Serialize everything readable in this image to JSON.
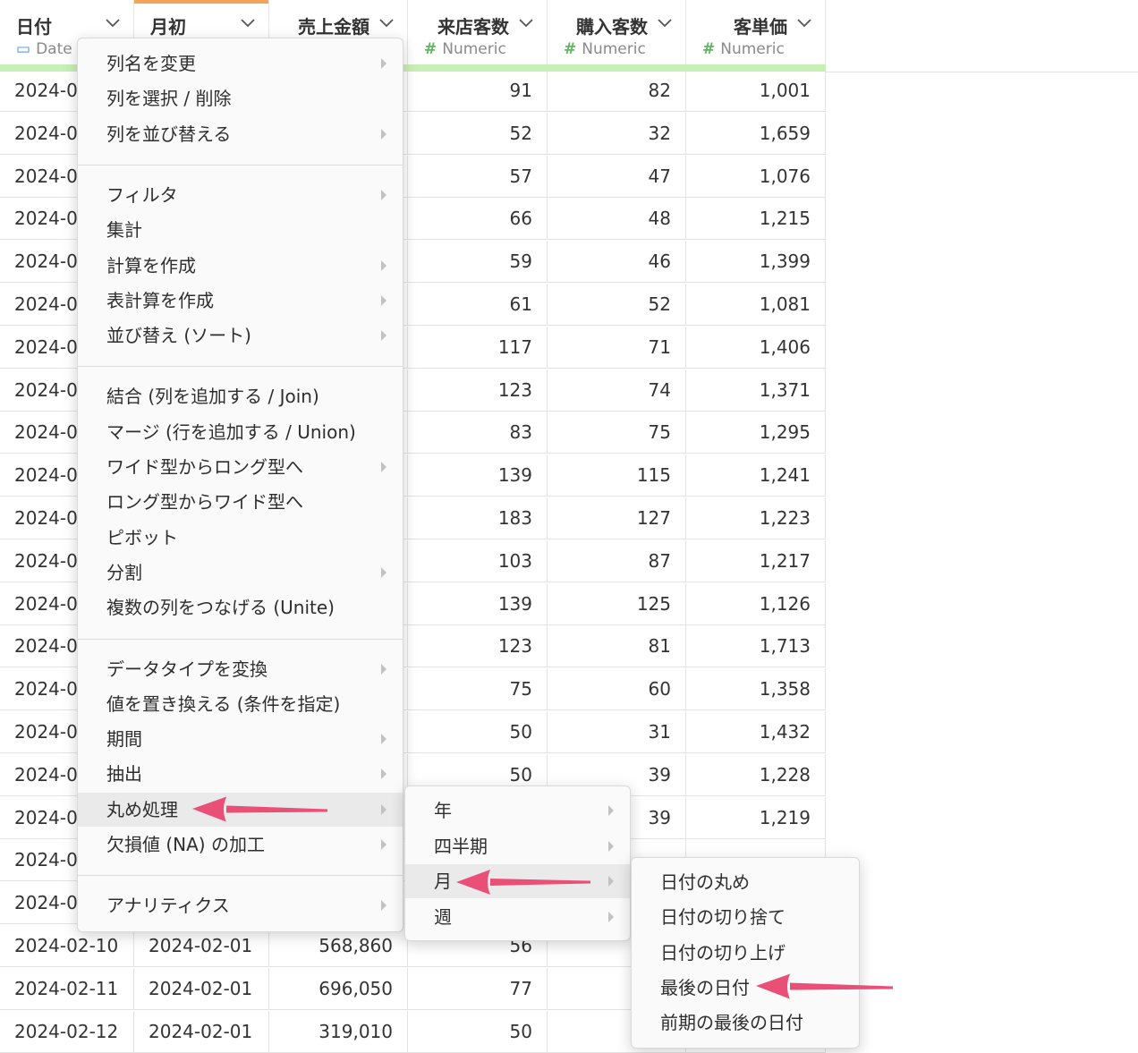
{
  "columns": [
    {
      "name": "日付",
      "type": "Date"
    },
    {
      "name": "月初",
      "type": ""
    },
    {
      "name": "売上金額",
      "type": ""
    },
    {
      "name": "来店客数",
      "type": "Numeric"
    },
    {
      "name": "購入客数",
      "type": "Numeric"
    },
    {
      "name": "客単価",
      "type": "Numeric"
    }
  ],
  "rows": [
    [
      "2024-0",
      "",
      "",
      "91",
      "82",
      "1,001"
    ],
    [
      "2024-0",
      "",
      "",
      "52",
      "32",
      "1,659"
    ],
    [
      "2024-0",
      "",
      "",
      "57",
      "47",
      "1,076"
    ],
    [
      "2024-0",
      "",
      "",
      "66",
      "48",
      "1,215"
    ],
    [
      "2024-0",
      "",
      "",
      "59",
      "46",
      "1,399"
    ],
    [
      "2024-0",
      "",
      "",
      "61",
      "52",
      "1,081"
    ],
    [
      "2024-0",
      "",
      "",
      "117",
      "71",
      "1,406"
    ],
    [
      "2024-0",
      "",
      "",
      "123",
      "74",
      "1,371"
    ],
    [
      "2024-0",
      "",
      "",
      "83",
      "75",
      "1,295"
    ],
    [
      "2024-0",
      "",
      "",
      "139",
      "115",
      "1,241"
    ],
    [
      "2024-0",
      "",
      "",
      "183",
      "127",
      "1,223"
    ],
    [
      "2024-0",
      "",
      "",
      "103",
      "87",
      "1,217"
    ],
    [
      "2024-0",
      "",
      "",
      "139",
      "125",
      "1,126"
    ],
    [
      "2024-0",
      "",
      "",
      "123",
      "81",
      "1,713"
    ],
    [
      "2024-0",
      "",
      "",
      "75",
      "60",
      "1,358"
    ],
    [
      "2024-0",
      "",
      "",
      "50",
      "31",
      "1,432"
    ],
    [
      "2024-0",
      "",
      "",
      "50",
      "39",
      "1,228"
    ],
    [
      "2024-0",
      "",
      "",
      "",
      "39",
      "1,219"
    ],
    [
      "2024-0",
      "",
      "",
      "",
      "",
      ""
    ],
    [
      "2024-0",
      "",
      "",
      "",
      "",
      ""
    ],
    [
      "2024-02-10",
      "2024-02-01",
      "568,860",
      "56",
      "",
      ""
    ],
    [
      "2024-02-11",
      "2024-02-01",
      "696,050",
      "77",
      "",
      ""
    ],
    [
      "2024-02-12",
      "2024-02-01",
      "319,010",
      "50",
      "",
      ""
    ]
  ],
  "main_menu": {
    "groups": [
      [
        {
          "label": "列名を変更",
          "submenu": true
        },
        {
          "label": "列を選択 / 削除",
          "submenu": false
        },
        {
          "label": "列を並び替える",
          "submenu": true
        }
      ],
      [
        {
          "label": "フィルタ",
          "submenu": true
        },
        {
          "label": "集計",
          "submenu": false
        },
        {
          "label": "計算を作成",
          "submenu": true
        },
        {
          "label": "表計算を作成",
          "submenu": true
        },
        {
          "label": "並び替え (ソート)",
          "submenu": true
        }
      ],
      [
        {
          "label": "結合 (列を追加する / Join)",
          "submenu": false
        },
        {
          "label": "マージ (行を追加する / Union)",
          "submenu": false
        },
        {
          "label": "ワイド型からロング型へ",
          "submenu": true
        },
        {
          "label": "ロング型からワイド型へ",
          "submenu": false
        },
        {
          "label": "ピボット",
          "submenu": false
        },
        {
          "label": "分割",
          "submenu": true
        },
        {
          "label": "複数の列をつなげる (Unite)",
          "submenu": false
        }
      ],
      [
        {
          "label": "データタイプを変換",
          "submenu": true
        },
        {
          "label": "値を置き換える (条件を指定)",
          "submenu": false
        },
        {
          "label": "期間",
          "submenu": true
        },
        {
          "label": "抽出",
          "submenu": true
        },
        {
          "label": "丸め処理",
          "submenu": true,
          "highlighted": true
        },
        {
          "label": "欠損値 (NA) の加工",
          "submenu": true
        }
      ],
      [
        {
          "label": "アナリティクス",
          "submenu": true
        }
      ]
    ]
  },
  "round_menu": [
    {
      "label": "年",
      "submenu": true
    },
    {
      "label": "四半期",
      "submenu": true
    },
    {
      "label": "月",
      "submenu": true,
      "highlighted": true
    },
    {
      "label": "週",
      "submenu": true
    }
  ],
  "month_menu": [
    {
      "label": "日付の丸め"
    },
    {
      "label": "日付の切り捨て"
    },
    {
      "label": "日付の切り上げ"
    },
    {
      "label": "最後の日付"
    },
    {
      "label": "前期の最後の日付"
    }
  ],
  "colors": {
    "accent_arrow": "#e94f77",
    "header_underline": "#c8efb4",
    "active_column": "#f2a55a",
    "numeric_icon": "#5cb85c",
    "date_icon": "#4a90d9"
  },
  "icons": {
    "submenu": "chevron-right-icon",
    "column_menu": "chevron-down-icon",
    "numeric_type": "hash-icon",
    "date_type": "calendar-icon"
  }
}
